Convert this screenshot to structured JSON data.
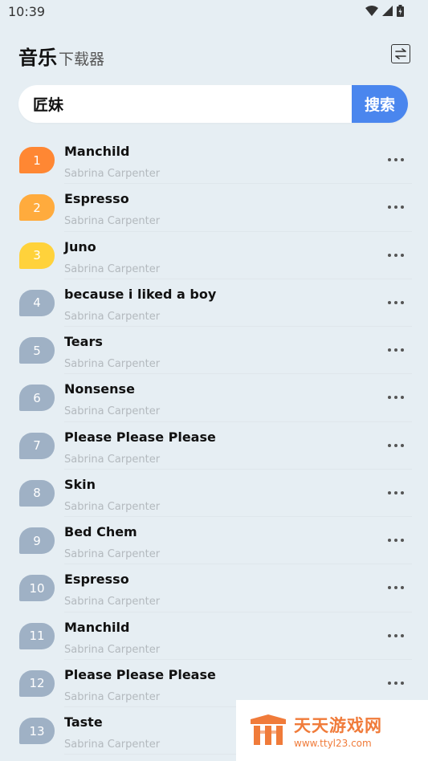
{
  "status_bar": {
    "time": "10:39",
    "icons": [
      "wifi-icon",
      "signal-icon",
      "battery-icon"
    ]
  },
  "header": {
    "title": "音乐",
    "subtitle": "下载器",
    "swap_icon": "swap-icon"
  },
  "search": {
    "value": "匠妹",
    "button_label": "搜索"
  },
  "songs": [
    {
      "rank": "1",
      "title": "Manchild",
      "artist": "Sabrina Carpenter",
      "badge_color": "#ff8733"
    },
    {
      "rank": "2",
      "title": "Espresso",
      "artist": "Sabrina Carpenter",
      "badge_color": "#ffab3d"
    },
    {
      "rank": "3",
      "title": "Juno",
      "artist": "Sabrina Carpenter",
      "badge_color": "#ffd23b"
    },
    {
      "rank": "4",
      "title": "because i liked a boy",
      "artist": "Sabrina Carpenter",
      "badge_color": "#9fb1c5"
    },
    {
      "rank": "5",
      "title": "Tears",
      "artist": "Sabrina Carpenter",
      "badge_color": "#9fb1c5"
    },
    {
      "rank": "6",
      "title": "Nonsense",
      "artist": "Sabrina Carpenter",
      "badge_color": "#9fb1c5"
    },
    {
      "rank": "7",
      "title": "Please Please Please",
      "artist": "Sabrina Carpenter",
      "badge_color": "#9fb1c5"
    },
    {
      "rank": "8",
      "title": "Skin",
      "artist": "Sabrina Carpenter",
      "badge_color": "#9fb1c5"
    },
    {
      "rank": "9",
      "title": "Bed Chem",
      "artist": "Sabrina Carpenter",
      "badge_color": "#9fb1c5"
    },
    {
      "rank": "10",
      "title": "Espresso",
      "artist": "Sabrina Carpenter",
      "badge_color": "#9fb1c5"
    },
    {
      "rank": "11",
      "title": "Manchild",
      "artist": "Sabrina Carpenter",
      "badge_color": "#9fb1c5"
    },
    {
      "rank": "12",
      "title": "Please Please Please",
      "artist": "Sabrina Carpenter",
      "badge_color": "#9fb1c5"
    },
    {
      "rank": "13",
      "title": "Taste",
      "artist": "Sabrina Carpenter",
      "badge_color": "#9fb1c5"
    }
  ],
  "watermark": {
    "name": "天天游戏网",
    "url": "www.ttyl23.com"
  },
  "colors": {
    "background": "#e6eef3",
    "accent": "#4a86ee",
    "watermark": "#f07b3a"
  }
}
